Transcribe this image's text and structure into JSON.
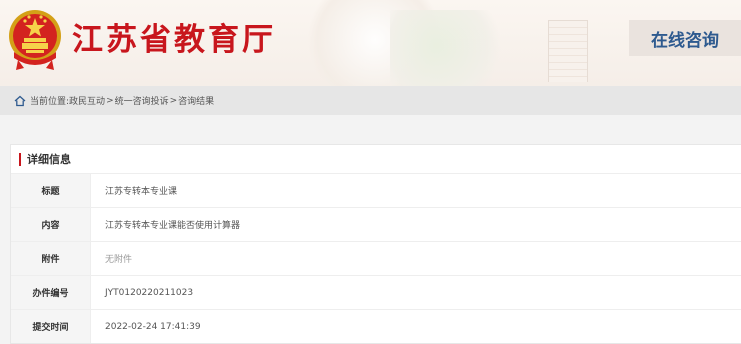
{
  "header": {
    "site_title": "江苏省教育厅",
    "section_tag": "在线咨询",
    "emblem_icon": "national-emblem-icon",
    "brand_color": "#c8161d",
    "tag_color": "#2e5a8f"
  },
  "breadcrumb": {
    "prefix": "当前位置:",
    "items": [
      "政民互动",
      "统一咨询投诉",
      "咨询结果"
    ],
    "separator": ">",
    "icon": "home-icon"
  },
  "detail": {
    "title": "详细信息",
    "rows": [
      {
        "label": "标题",
        "value": "江苏专转本专业课"
      },
      {
        "label": "内容",
        "value": "江苏专转本专业课能否使用计算器"
      },
      {
        "label": "附件",
        "value": "无附件"
      },
      {
        "label": "办件编号",
        "value": "JYT0120220211023"
      },
      {
        "label": "提交时间",
        "value": "2022-02-24 17:41:39"
      }
    ]
  }
}
